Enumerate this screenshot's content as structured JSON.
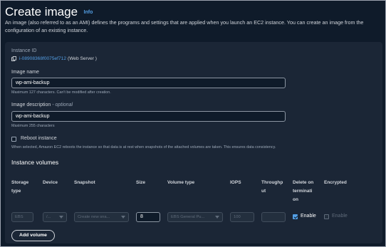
{
  "page": {
    "title": "Create image",
    "info_link": "Info",
    "description": "An image (also referred to as an AMI) defines the programs and settings that are applied when you launch an EC2 instance. You can create an image from the configuration of an existing instance."
  },
  "instance": {
    "label": "Instance ID",
    "id": "i-08908368f0075ef712",
    "name": "(Web Server )"
  },
  "image_name": {
    "label": "Image name",
    "value": "wp-ami-backup",
    "hint": "Maximum 127 characters. Can't be modified after creation."
  },
  "image_description": {
    "label": "Image description",
    "optional": "- optional",
    "value": "wp-ami-backup",
    "hint": "Maximum 255 characters"
  },
  "reboot": {
    "label": "Reboot instance",
    "checked": false,
    "hint": "When selected, Amazon EC2 reboots the instance so that data is at rest when snapshots of the attached volumes are taken. This ensures data consistency."
  },
  "volumes": {
    "title": "Instance volumes",
    "columns": {
      "storage_type": [
        "Storage",
        "type"
      ],
      "device": [
        "Device"
      ],
      "snapshot": [
        "Snapshot"
      ],
      "size": [
        "Size"
      ],
      "volume_type": [
        "Volume type"
      ],
      "iops": [
        "IOPS"
      ],
      "throughput": [
        "Throughp",
        "ut"
      ],
      "delete_on_termination": [
        "Delete on",
        "terminati",
        "on"
      ],
      "encrypted": [
        "Encrypted"
      ]
    },
    "row": {
      "storage_type": "EBS",
      "device": "/...",
      "snapshot": "Create new sna...",
      "size": "8",
      "volume_type": "EBS General Pu...",
      "iops": "100",
      "throughput": "",
      "delete_label": "Enable",
      "delete_checked": true,
      "encrypted_label": "Enable",
      "encrypted_checked": false
    },
    "add_button": "Add volume"
  },
  "colors": {
    "background": "#0f1b2a",
    "card": "#1b2636",
    "accent": "#539fe5",
    "disabled_text": "#5f6b7a"
  }
}
